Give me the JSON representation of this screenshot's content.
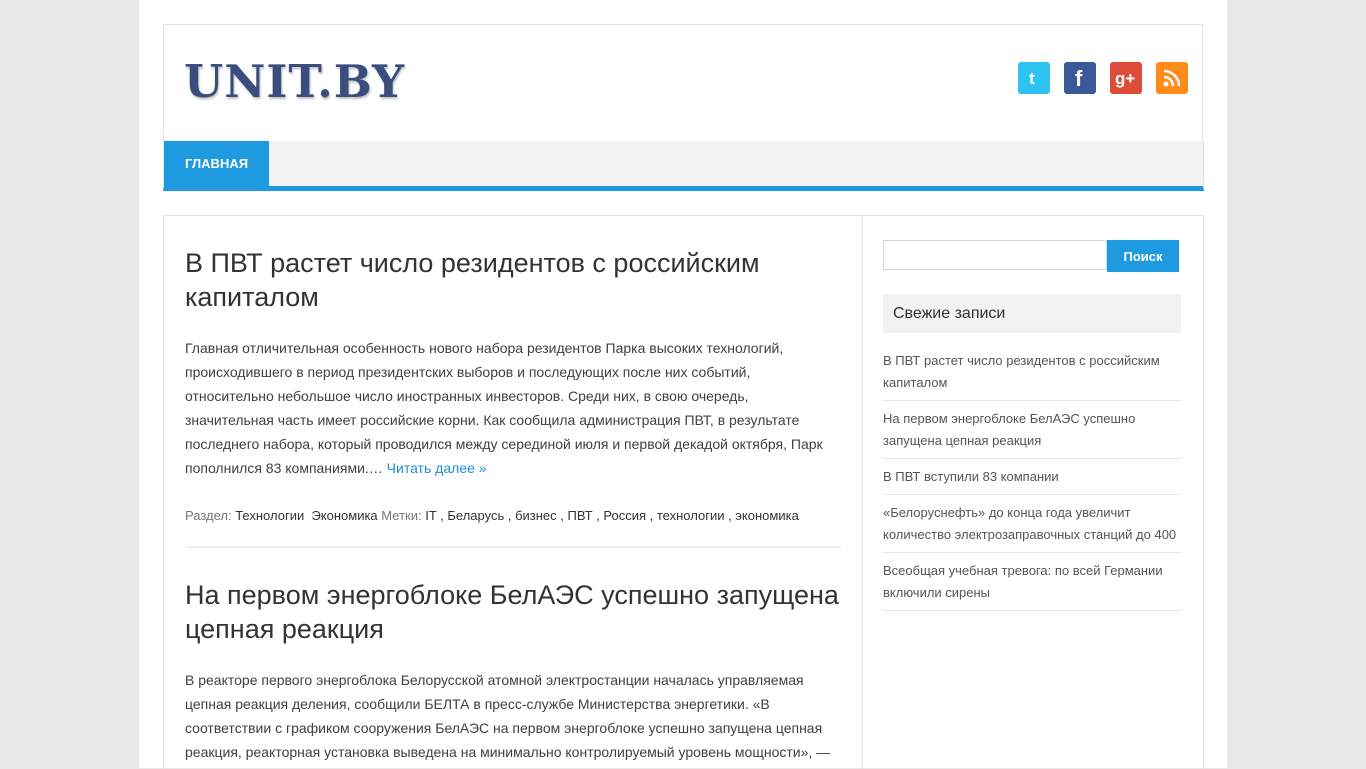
{
  "site": {
    "logo": "UNIT.BY"
  },
  "social": [
    {
      "name": "twitter-icon",
      "glyph": "t",
      "color": "#2ec3f0"
    },
    {
      "name": "facebook-icon",
      "glyph": "f",
      "color": "#3b5998"
    },
    {
      "name": "google-plus-icon",
      "glyph": "g+",
      "color": "#dd4b39"
    },
    {
      "name": "rss-icon",
      "glyph": "◉",
      "color": "#ff8c1a"
    }
  ],
  "nav": {
    "items": [
      {
        "label": "Главная"
      }
    ]
  },
  "posts": [
    {
      "title": "В ПВТ растет число резидентов с российским капиталом",
      "excerpt": "Главная отличительная особенность нового набора резидентов Парка высоких технологий, происходившего в период президентских выборов и последующих после них событий, относительно небольшое число иностранных инвесторов. Среди них, в свою очередь, значительная часть имеет российские корни. Как сообщила администрация ПВТ, в результате последнего набора, который проводился между серединой июля и первой декадой октября, Парк пополнился 83 компаниями.…",
      "more": "Читать далее »",
      "section_label": "Раздел:",
      "sections": "Технологии  Экономика",
      "tags_label": "Метки:",
      "tags": "IT , Беларусь , бизнес , ПВТ , Россия , технологии , экономика"
    },
    {
      "title": "На первом энергоблоке БелАЭС успешно запущена цепная реакция",
      "excerpt": "В реакторе первого энергоблока Белорусской атомной электростанции началась управляемая цепная реакция деления, сообщили БЕЛТА в пресс-службе Министерства энергетики. «В соответствии с графиком сооружения БелАЭС на первом энергоблоке успешно запущена цепная реакция, реакторная установка выведена на минимально контролируемый уровень мощности», —"
    }
  ],
  "sidebar": {
    "search_button": "Поиск",
    "recent_title": "Свежие записи",
    "recent": [
      "В ПВТ растет число резидентов с российским капиталом",
      "На первом энергоблоке БелАЭС успешно запущена цепная реакция",
      "В ПВТ вступили 83 компании",
      "«Белоруснефть» до конца года увеличит количество электрозаправочных станций до 400",
      "Всеобщая учебная тревога: по всей Германии включили сирены"
    ]
  }
}
